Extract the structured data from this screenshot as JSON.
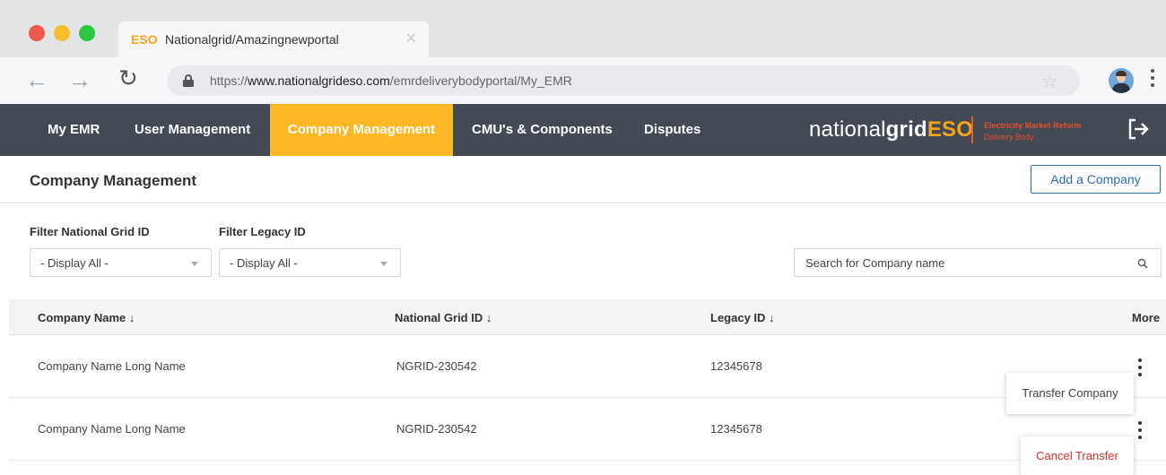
{
  "browser": {
    "tab_brand": "ESO",
    "tab_title": "Nationalgrid/Amazingnewportal",
    "url_prefix": "https://",
    "url_host": "www.nationalgrideso.com",
    "url_path": "/emrdeliverybodyportal/My_EMR",
    "icons": [
      "back-arrow-icon",
      "forward-arrow-icon",
      "reload-icon",
      "lock-icon",
      "star-icon",
      "kebab-menu-icon"
    ]
  },
  "nav": {
    "items": [
      {
        "label": "My EMR",
        "active": false
      },
      {
        "label": "User Management",
        "active": false
      },
      {
        "label": "Company Management",
        "active": true
      },
      {
        "label": "CMU's & Components",
        "active": false
      },
      {
        "label": "Disputes",
        "active": false
      }
    ],
    "brand": {
      "part1": "national",
      "part2": "grid",
      "part3": "ESO"
    },
    "emr_line1": "Electricity Market Reform",
    "emr_line2": "Delivery Body",
    "colors": {
      "bar": "#434a54",
      "active": "#fbb724",
      "brand_accent": "#f7a41c"
    }
  },
  "page": {
    "title": "Company Management",
    "add_button": "Add a Company"
  },
  "filters": {
    "ngid_label": "Filter National Grid ID",
    "ngid_value": "- Display All -",
    "legacy_label": "Filter Legacy ID",
    "legacy_value": "- Display All -",
    "search_placeholder": "Search for Company name"
  },
  "table": {
    "headers": {
      "company": "Company Name ↓",
      "ngid": "National Grid ID ↓",
      "legacy": "Legacy ID ↓",
      "more": "More"
    },
    "rows": [
      {
        "company": "Company Name Long Name",
        "ngid": "NGRID-230542",
        "legacy": "12345678"
      },
      {
        "company": "Company Name Long Name",
        "ngid": "NGRID-230542",
        "legacy": "12345678"
      }
    ]
  },
  "menus": {
    "transfer": "Transfer Company",
    "cancel": "Cancel Transfer"
  }
}
